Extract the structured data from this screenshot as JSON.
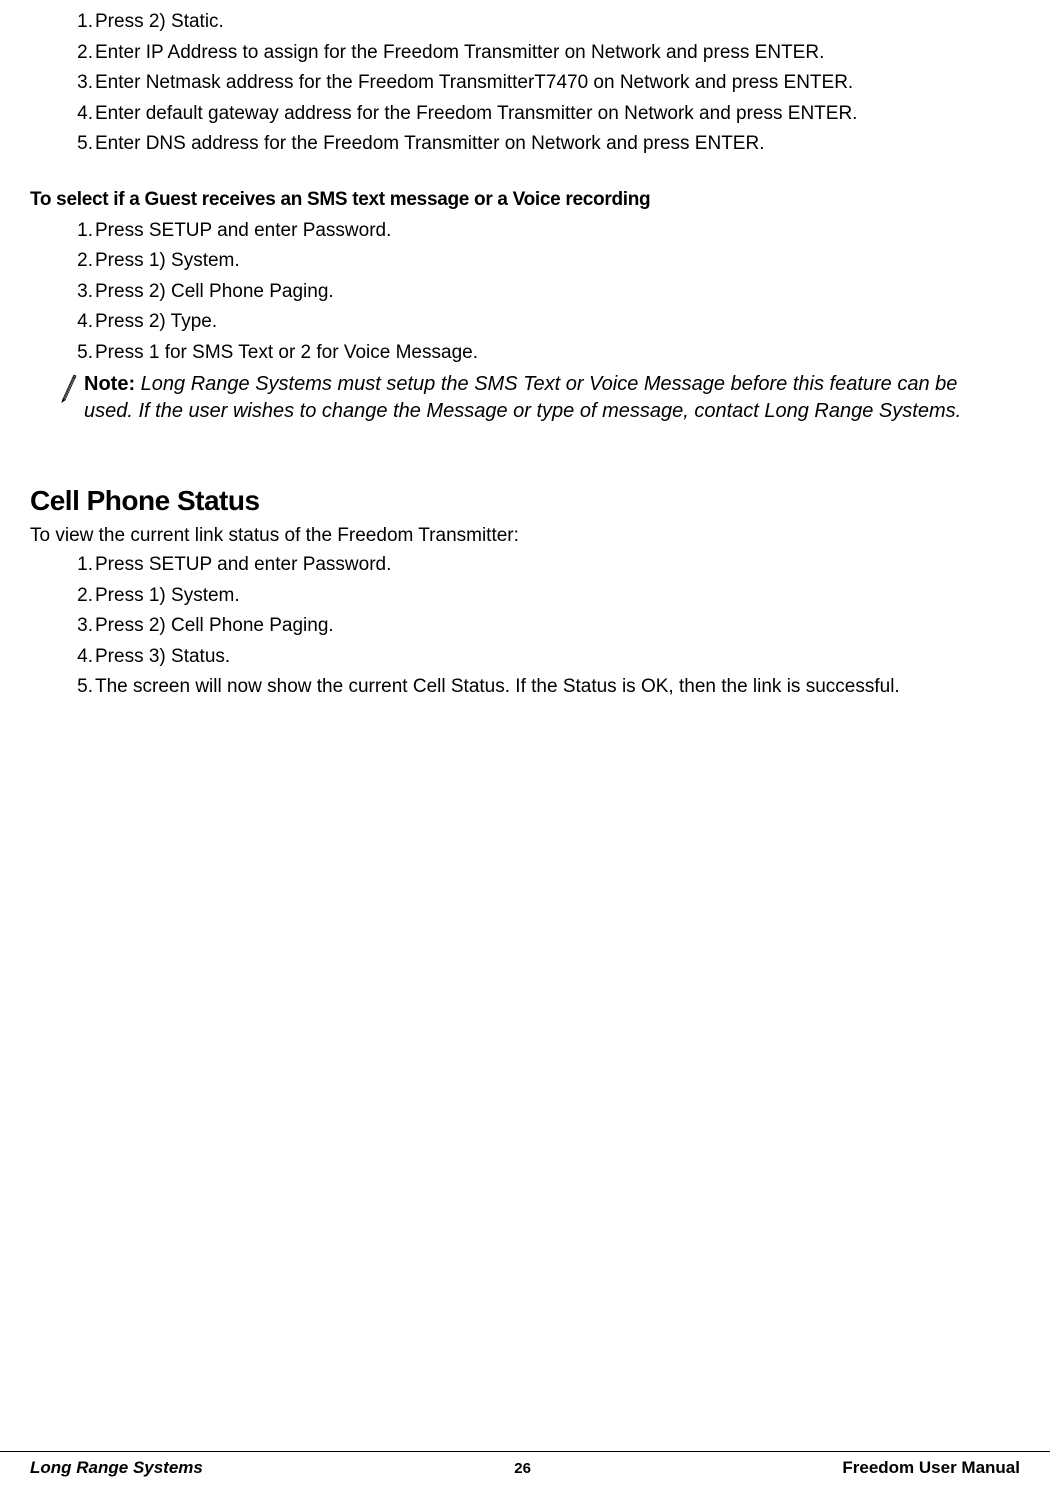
{
  "list1": {
    "items": [
      {
        "num": "1.",
        "text": "Press 2) Static."
      },
      {
        "num": "2.",
        "text": "Enter IP Address to assign for the Freedom Transmitter on Network and press ENTER."
      },
      {
        "num": "3.",
        "text": "Enter Netmask address for the Freedom TransmitterT7470 on Network and press ENTER."
      },
      {
        "num": "4.",
        "text": "Enter default gateway address for the Freedom Transmitter on Network and press ENTER."
      },
      {
        "num": "5.",
        "text": "Enter DNS address for  the Freedom Transmitter on Network and press ENTER."
      }
    ]
  },
  "subheading1": "To select if a Guest receives an SMS text message or a Voice recording",
  "list2": {
    "items": [
      {
        "num": "1.",
        "text": "Press SETUP and enter Password."
      },
      {
        "num": "2.",
        "text": "Press 1) System."
      },
      {
        "num": "3.",
        "text": "Press 2) Cell Phone Paging."
      },
      {
        "num": "4.",
        "text": "Press 2) Type."
      },
      {
        "num": "5.",
        "text": "Press 1 for SMS Text or 2 for Voice Message."
      }
    ]
  },
  "note": {
    "label": "Note:",
    "body": "Long Range Systems must setup the SMS Text or Voice Message before this feature can be used.  If the user wishes to change the Message or type of message, contact Long Range Systems."
  },
  "section_heading": "Cell Phone Status",
  "body_intro": "To view the current link status of the Freedom Transmitter:",
  "list3": {
    "items": [
      {
        "num": "1.",
        "text": "Press SETUP and enter Password."
      },
      {
        "num": "2.",
        "text": "Press 1) System."
      },
      {
        "num": "3.",
        "text": "Press 2) Cell Phone Paging."
      },
      {
        "num": "4.",
        "text": "Press 3) Status."
      },
      {
        "num": "5.",
        "text": "The screen will now show the current Cell Status.  If the Status is OK, then the link is successful."
      }
    ]
  },
  "footer": {
    "left": "Long Range Systems",
    "center": "26",
    "right": "Freedom User Manual"
  }
}
